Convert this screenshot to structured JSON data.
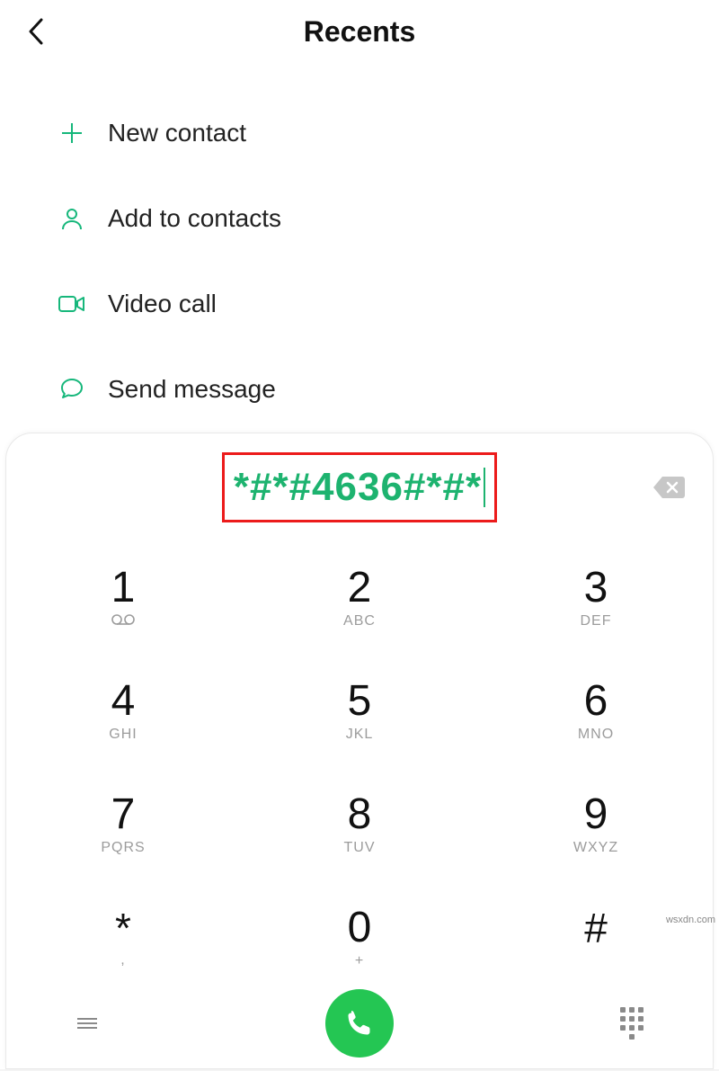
{
  "header": {
    "title": "Recents"
  },
  "actions": {
    "new_contact": "New contact",
    "add_to_contacts": "Add to contacts",
    "video_call": "Video call",
    "send_message": "Send message"
  },
  "dialer": {
    "entered": "*#*#4636#*#*",
    "keys": [
      {
        "d": "1",
        "s": "∞"
      },
      {
        "d": "2",
        "s": "ABC"
      },
      {
        "d": "3",
        "s": "DEF"
      },
      {
        "d": "4",
        "s": "GHI"
      },
      {
        "d": "5",
        "s": "JKL"
      },
      {
        "d": "6",
        "s": "MNO"
      },
      {
        "d": "7",
        "s": "PQRS"
      },
      {
        "d": "8",
        "s": "TUV"
      },
      {
        "d": "9",
        "s": "WXYZ"
      },
      {
        "d": "*",
        "s": ","
      },
      {
        "d": "0",
        "s": "+"
      },
      {
        "d": "#",
        "s": ""
      }
    ]
  },
  "watermark": "wsxdn.com"
}
